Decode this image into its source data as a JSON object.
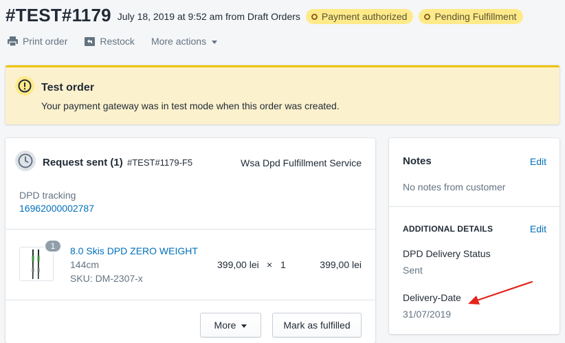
{
  "header": {
    "order_name": "#TEST#1179",
    "meta": "July 18, 2019 at 9:52 am from Draft Orders",
    "badges": [
      "Payment authorized",
      "Pending Fulfillment"
    ]
  },
  "actions": {
    "print": "Print order",
    "restock": "Restock",
    "more": "More actions"
  },
  "banner": {
    "title": "Test order",
    "text": "Your payment gateway was in test mode when this order was created."
  },
  "fulfillment": {
    "title": "Request sent (1)",
    "id": "#TEST#1179-F5",
    "service": "Wsa Dpd Fulfillment Service",
    "tracking_label": "DPD tracking",
    "tracking_number": "16962000002787",
    "item": {
      "quantity_badge": "1",
      "name": "8.0 Skis DPD ZERO WEIGHT",
      "variant": "144cm",
      "sku": "SKU: DM-2307-x",
      "price": "399,00 lei",
      "times": "×",
      "qty": "1",
      "total": "399,00 lei"
    },
    "more_button": "More",
    "mark_button": "Mark as fulfilled"
  },
  "notes": {
    "title": "Notes",
    "edit": "Edit",
    "empty": "No notes from customer",
    "additional_title": "ADDITIONAL DETAILS",
    "additional_edit": "Edit",
    "fields": [
      {
        "label": "DPD Delivery Status",
        "value": "Sent"
      },
      {
        "label": "Delivery-Date",
        "value": "31/07/2019"
      }
    ]
  },
  "colors": {
    "link": "#006fbb",
    "badge_bg": "#ffea8a",
    "banner_bg": "#fcf1cd",
    "banner_border": "#eec200",
    "annotation_arrow": "#e3231c"
  }
}
